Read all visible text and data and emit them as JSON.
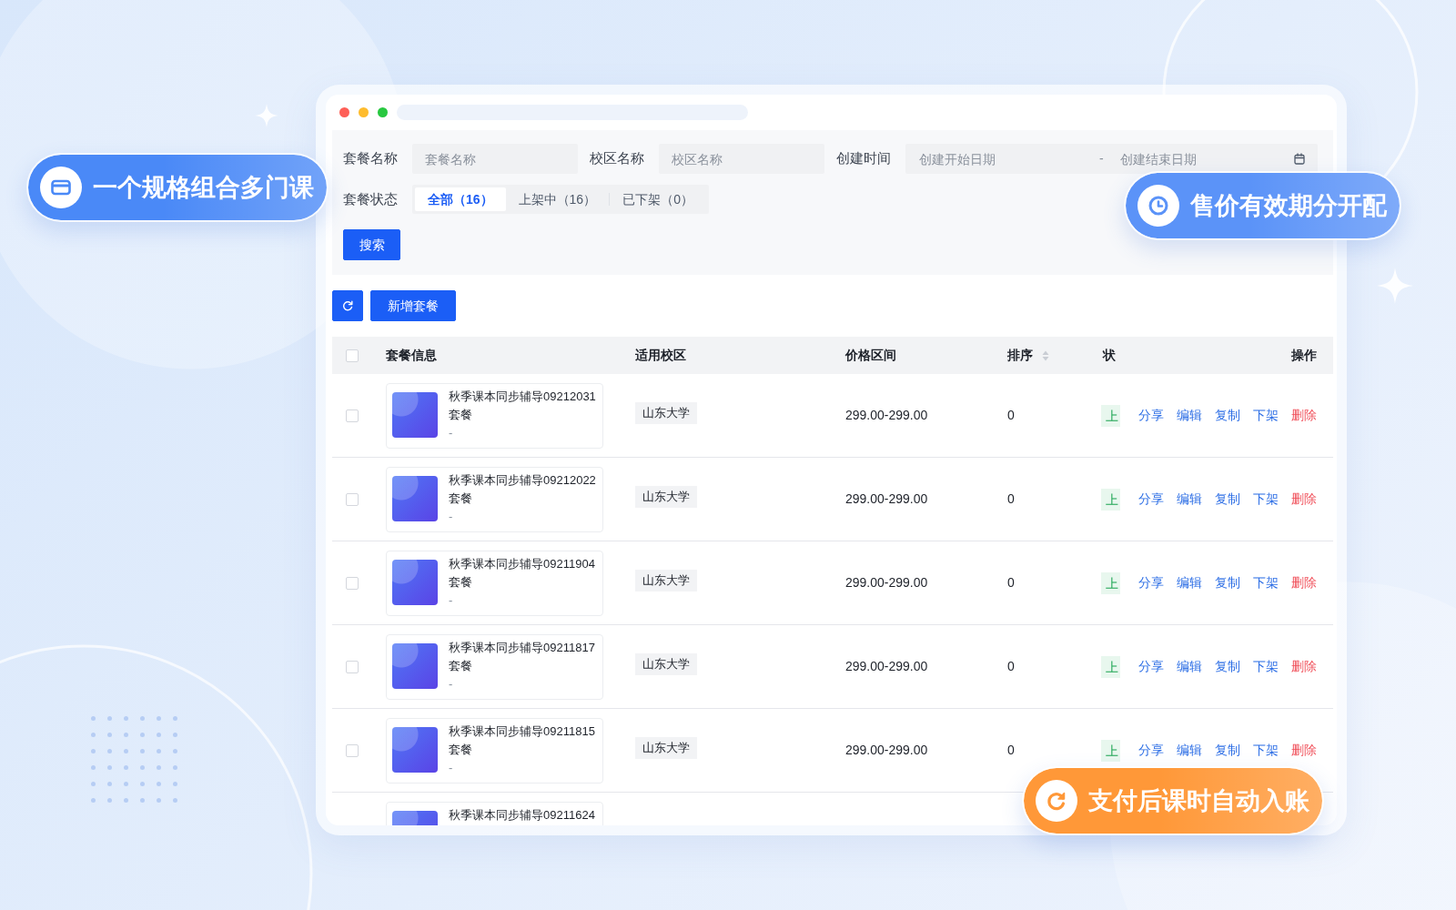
{
  "callouts": [
    {
      "kind": "card",
      "text": "一个规格组合多门课",
      "color": "#4a89f7"
    },
    {
      "kind": "clock",
      "text": "售价有效期分开配",
      "color": "#5b93f8"
    },
    {
      "kind": "cycle",
      "text": "支付后课时自动入账",
      "color": "#ff9838"
    }
  ],
  "filters": [
    {
      "kind": "text",
      "label": "套餐名称",
      "placeholder": "套餐名称"
    },
    {
      "kind": "text",
      "label": "校区名称",
      "placeholder": "校区名称"
    },
    {
      "kind": "date_range",
      "label": "创建时间",
      "start_placeholder": "创建开始日期",
      "separator": "-",
      "end_placeholder": "创建结束日期"
    }
  ],
  "status_filter": {
    "label": "套餐状态",
    "options": [
      {
        "label": "全部（16）",
        "selected": true
      },
      {
        "label": "上架中（16）",
        "selected": false
      },
      {
        "label": "已下架（0）",
        "selected": false
      }
    ]
  },
  "search_button": "搜索",
  "toolbar": {
    "add_button": "新增套餐"
  },
  "table": {
    "select_all_checked": false,
    "columns": [
      {
        "label": "套餐信息",
        "sortable": false
      },
      {
        "label": "适用校区",
        "sortable": false
      },
      {
        "label": "价格区间",
        "sortable": false
      },
      {
        "label": "排序",
        "sortable": true
      },
      {
        "label": "状",
        "sortable": false
      },
      {
        "label": "操作",
        "sortable": false
      }
    ],
    "rows": [
      {
        "checked": false,
        "name": "秋季课本同步辅导09212031",
        "type": "套餐",
        "note": "-",
        "campus": "山东大学",
        "price": "299.00-299.00",
        "sort": "0",
        "status": "上",
        "actions": [
          {
            "label": "分享",
            "kind": "link"
          },
          {
            "label": "编辑",
            "kind": "link"
          },
          {
            "label": "复制",
            "kind": "link"
          },
          {
            "label": "下架",
            "kind": "link"
          },
          {
            "label": "删除",
            "kind": "danger"
          }
        ]
      },
      {
        "checked": false,
        "name": "秋季课本同步辅导09212022",
        "type": "套餐",
        "note": "-",
        "campus": "山东大学",
        "price": "299.00-299.00",
        "sort": "0",
        "status": "上",
        "actions": [
          {
            "label": "分享",
            "kind": "link"
          },
          {
            "label": "编辑",
            "kind": "link"
          },
          {
            "label": "复制",
            "kind": "link"
          },
          {
            "label": "下架",
            "kind": "link"
          },
          {
            "label": "删除",
            "kind": "danger"
          }
        ]
      },
      {
        "checked": false,
        "name": "秋季课本同步辅导09211904",
        "type": "套餐",
        "note": "-",
        "campus": "山东大学",
        "price": "299.00-299.00",
        "sort": "0",
        "status": "上",
        "actions": [
          {
            "label": "分享",
            "kind": "link"
          },
          {
            "label": "编辑",
            "kind": "link"
          },
          {
            "label": "复制",
            "kind": "link"
          },
          {
            "label": "下架",
            "kind": "link"
          },
          {
            "label": "删除",
            "kind": "danger"
          }
        ]
      },
      {
        "checked": false,
        "name": "秋季课本同步辅导09211817",
        "type": "套餐",
        "note": "-",
        "campus": "山东大学",
        "price": "299.00-299.00",
        "sort": "0",
        "status": "上",
        "actions": [
          {
            "label": "分享",
            "kind": "link"
          },
          {
            "label": "编辑",
            "kind": "link"
          },
          {
            "label": "复制",
            "kind": "link"
          },
          {
            "label": "下架",
            "kind": "link"
          },
          {
            "label": "删除",
            "kind": "danger"
          }
        ]
      },
      {
        "checked": false,
        "name": "秋季课本同步辅导09211815",
        "type": "套餐",
        "note": "-",
        "campus": "山东大学",
        "price": "299.00-299.00",
        "sort": "0",
        "status": "上",
        "actions": [
          {
            "label": "分享",
            "kind": "link"
          },
          {
            "label": "编辑",
            "kind": "link"
          },
          {
            "label": "复制",
            "kind": "link"
          },
          {
            "label": "下架",
            "kind": "link"
          },
          {
            "label": "删除",
            "kind": "danger"
          }
        ]
      },
      {
        "name": "秋季课本同步辅导09211624"
      }
    ]
  }
}
